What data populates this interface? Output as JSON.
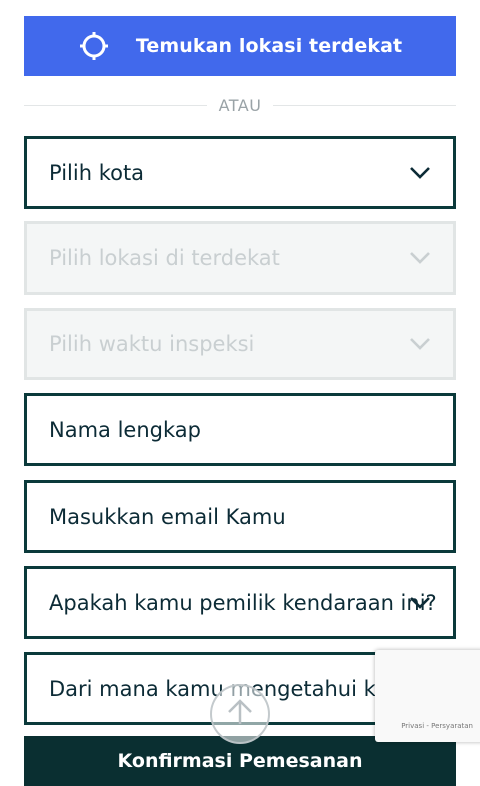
{
  "locate_button": {
    "label": "Temukan lokasi terdekat",
    "icon": "crosshair-icon"
  },
  "divider": {
    "label": "ATAU"
  },
  "fields": {
    "city": {
      "placeholder": "Pilih kota"
    },
    "nearest_location": {
      "placeholder": "Pilih lokasi di terdekat"
    },
    "inspection_time": {
      "placeholder": "Pilih waktu inspeksi"
    },
    "full_name": {
      "placeholder": "Nama lengkap"
    },
    "email": {
      "placeholder": "Masukkan email Kamu"
    },
    "vehicle_owner": {
      "placeholder": "Apakah kamu pemilik kendaraan ini?"
    },
    "referral_source": {
      "placeholder": "Dari mana kamu mengetahui kami?"
    }
  },
  "confirm_button": {
    "label": "Konfirmasi Pemesanan"
  },
  "recaptcha": {
    "footer": "Privasi - Persyaratan"
  },
  "colors": {
    "primary_blue": "#4169ec",
    "dark_teal": "#0a2f31",
    "field_border": "#0b3a3b",
    "disabled_bg": "#f4f6f6",
    "disabled_text": "#c9cfd1"
  }
}
